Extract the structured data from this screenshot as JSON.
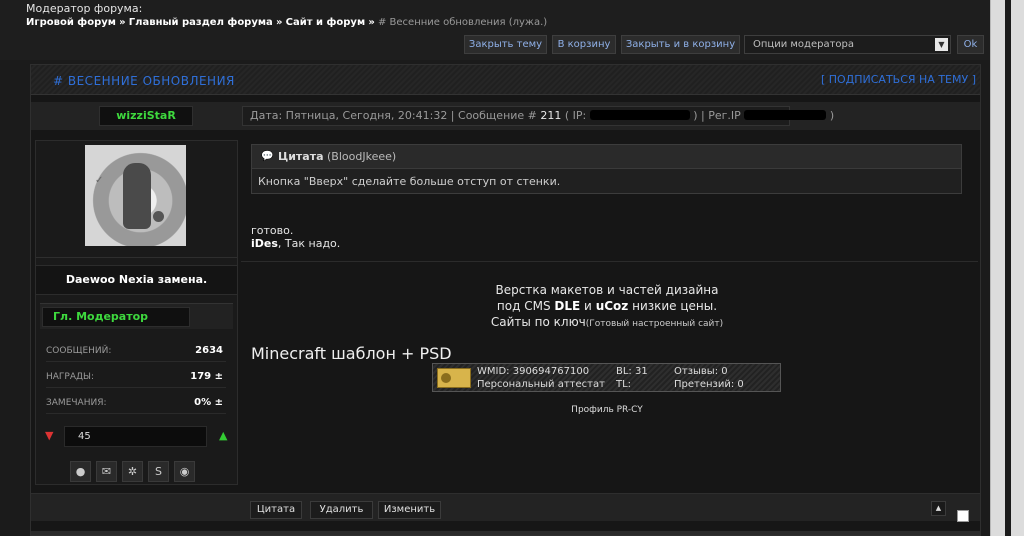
{
  "header": {
    "moderator_label": "Модератор форума:",
    "breadcrumb": [
      "Игровой форум",
      "Главный раздел форума",
      "Сайт и форум"
    ],
    "breadcrumb_sep": "»",
    "current": "# Весенние обновления (лужа.)"
  },
  "modtools": {
    "close_topic": "Закрыть тему",
    "to_trash": "В корзину",
    "close_and_trash": "Закрыть и в корзину",
    "options_select": "Опции модератора",
    "ok": "Ok"
  },
  "topic": {
    "title": "# ВЕСЕННИЕ ОБНОВЛЕНИЯ",
    "subscribe": "[ ПОДПИСАТЬСЯ НА ТЕМУ ]"
  },
  "post": {
    "username": "wizziStaR",
    "date_label": "Дата: Пятница, Сегодня, 20:41:32 | Сообщение #",
    "message_number": "211",
    "ip_label": "( IP:",
    "regip_label": ") | Рег.IP",
    "close_paren": ")"
  },
  "user": {
    "status": "Daewoo Nexia замена.",
    "rank": "Гл. Модератор",
    "stats": [
      {
        "label": "СООБЩЕНИЙ:",
        "value": "2634"
      },
      {
        "label": "НАГРАДЫ:",
        "value": "179 ±"
      },
      {
        "label": "ЗАМЕЧАНИЯ:",
        "value": "0% ±"
      }
    ],
    "reputation": "45",
    "icons": [
      "user-icon",
      "mail-icon",
      "settings-icon",
      "skype-icon",
      "web-icon"
    ]
  },
  "quote": {
    "label": "Цитата",
    "author": "(BloodJkeee)",
    "text": "Кнопка \"Вверх\" сделайте больше отступ от стенки."
  },
  "reply": {
    "line1": "готово.",
    "name": "iDes",
    "line2": ", Так надо."
  },
  "signature": {
    "line1": "Верстка макетов и частей дизайна",
    "line2_pre": "под CMS",
    "line2_dle": "DLE",
    "line2_and": "и",
    "line2_ucoz": "uCoz",
    "line2_post": "низкие цены.",
    "line3": "Сайты по ключ",
    "line3_small": "(Готовый настроенный сайт)",
    "minecraft": "Minecraft шаблон + PSD",
    "wm_id": "WMID: 390694767100",
    "wm_bl": "BL: 31",
    "wm_reviews": "Отзывы: 0",
    "wm_attest": "Персональный аттестат",
    "wm_tl": "TL:",
    "wm_claims": "Претензий: 0",
    "profile": "Профиль PR-CY"
  },
  "footer": {
    "quote": "Цитата",
    "delete": "Удалить",
    "edit": "Изменить"
  }
}
